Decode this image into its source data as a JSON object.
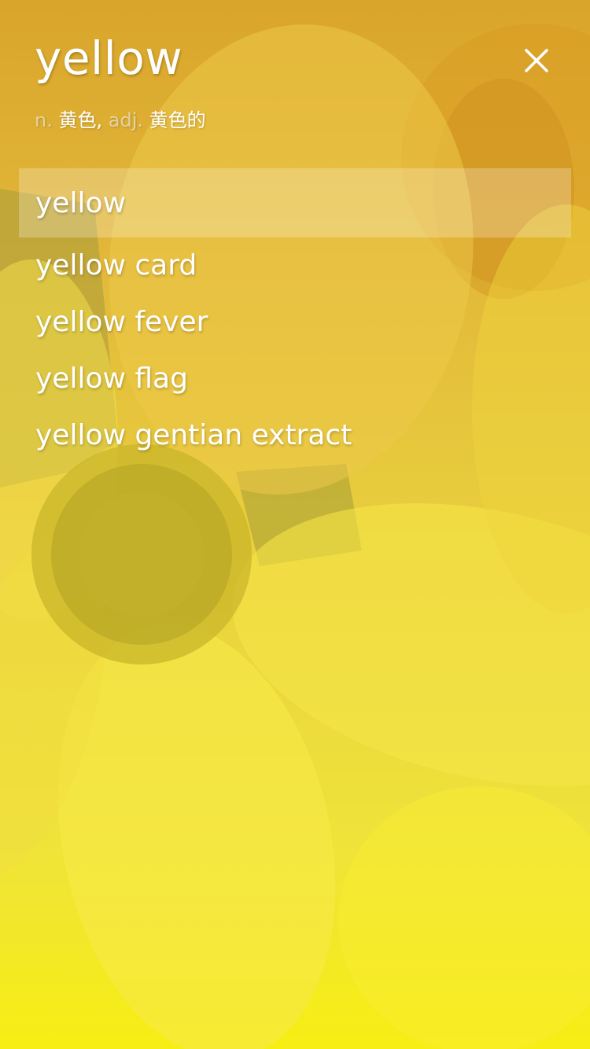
{
  "header": {
    "word": "yellow",
    "close_icon": "close-icon"
  },
  "definition": {
    "pos1": "n.",
    "meaning1": "黄色,",
    "pos2": "adj.",
    "meaning2": "黄色的"
  },
  "suggestions": [
    "yellow",
    "yellow card",
    "yellow fever",
    "yellow flag",
    "yellow gentian extract"
  ],
  "colors": {
    "text": "#ffffff",
    "highlight": "rgba(255,255,255,0.24)",
    "background_top": "#d9a52a",
    "background_bottom": "#f7ee14"
  }
}
